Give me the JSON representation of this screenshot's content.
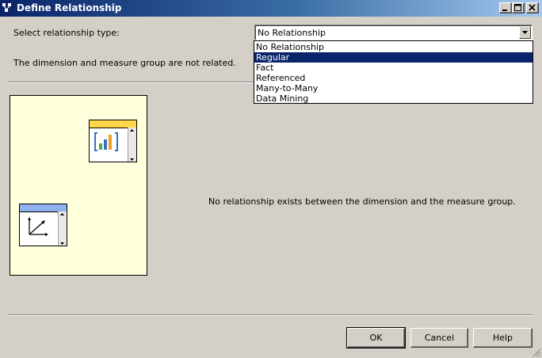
{
  "window": {
    "title": "Define Relationship"
  },
  "relationship": {
    "type_label": "Select relationship type:",
    "selected_value": "No Relationship",
    "options": [
      "No Relationship",
      "Regular",
      "Fact",
      "Referenced",
      "Many-to-Many",
      "Data Mining"
    ],
    "highlighted_option": "Regular",
    "status_text": "The dimension and measure group are not related."
  },
  "diagram": {
    "measure_group_icon": "bar-chart-icon",
    "dimension_icon": "axes-icon",
    "message": "No relationship exists between the dimension and the measure group."
  },
  "buttons": {
    "ok": "OK",
    "cancel": "Cancel",
    "help": "Help"
  },
  "colors": {
    "titlebar_start": "#0a246a",
    "dialog_bg": "#d4d0c8",
    "selection": "#0a246a",
    "diagram_bg": "#ffffdc",
    "measure_header": "#ffd84a",
    "dimension_header": "#8fb2ef"
  }
}
